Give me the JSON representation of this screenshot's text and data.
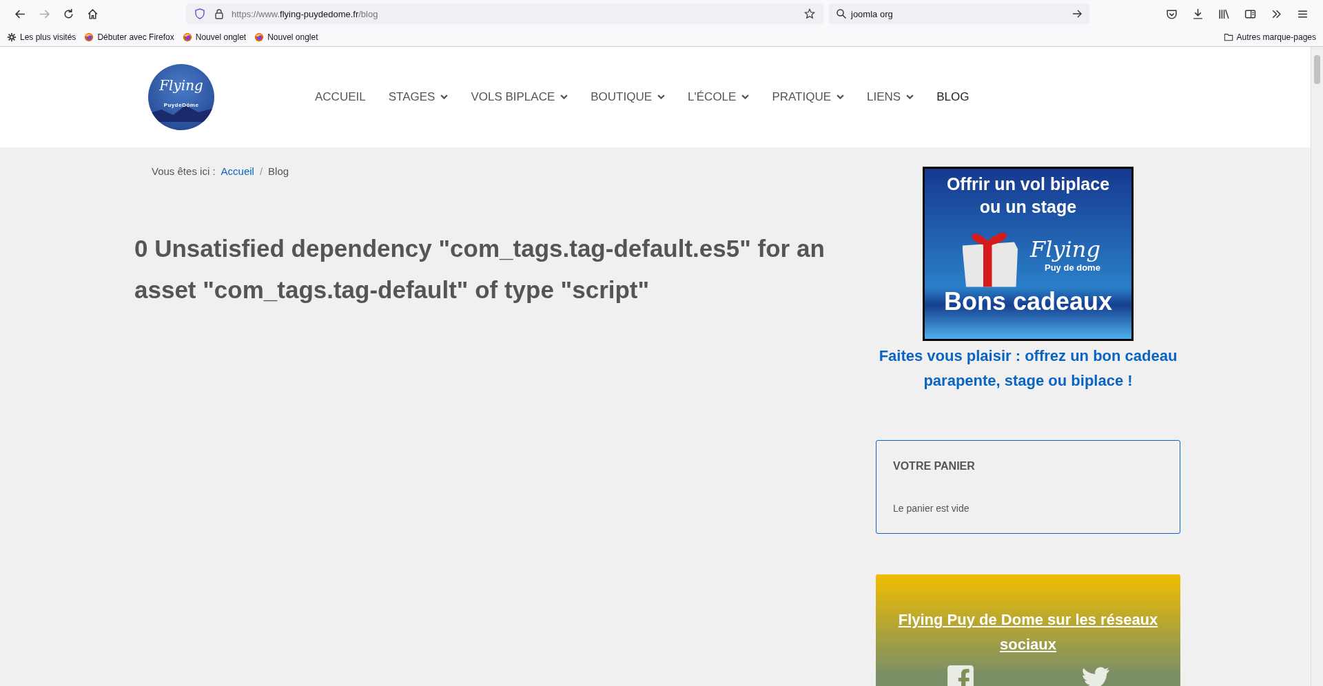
{
  "browser": {
    "url_prefix": "https://www.",
    "url_host": "flying-puydedome.fr",
    "url_path": "/blog",
    "search_value": "joomla org",
    "bookmarks": [
      {
        "label": "Les plus visités",
        "kind": "gear"
      },
      {
        "label": "Débuter avec Firefox",
        "kind": "firefox"
      },
      {
        "label": "Nouvel onglet",
        "kind": "firefox"
      },
      {
        "label": "Nouvel onglet",
        "kind": "firefox"
      }
    ],
    "other_bookmarks": "Autres marque-pages"
  },
  "logo": {
    "title": "Flying",
    "subtitle": "PuydeDôme"
  },
  "nav": [
    {
      "label": "ACCUEIL",
      "dropdown": false,
      "selected": false
    },
    {
      "label": "STAGES",
      "dropdown": true,
      "selected": false
    },
    {
      "label": "VOLS BIPLACE",
      "dropdown": true,
      "selected": false
    },
    {
      "label": "BOUTIQUE",
      "dropdown": true,
      "selected": false
    },
    {
      "label": "L'ÉCOLE",
      "dropdown": true,
      "selected": false
    },
    {
      "label": "PRATIQUE",
      "dropdown": true,
      "selected": false
    },
    {
      "label": "LIENS",
      "dropdown": true,
      "selected": false
    },
    {
      "label": "BLOG",
      "dropdown": false,
      "selected": true
    }
  ],
  "breadcrumb": {
    "prefix": "Vous êtes ici :",
    "separator": "/",
    "items": [
      {
        "label": "Accueil",
        "link": true
      },
      {
        "label": "Blog",
        "link": false
      }
    ]
  },
  "error_heading": "0 Unsatisfied dependency \"com_tags.tag-default.es5\" for an asset \"com_tags.tag-default\" of type \"script\"",
  "gift_banner": {
    "line_1": "Offrir un vol biplace",
    "line_2": "ou un stage",
    "brand": "Flying",
    "brand_sub": "Puy de dome",
    "footer": "Bons cadeaux"
  },
  "gift_caption": "Faites vous plaisir : offrez un bon cadeau parapente, stage ou biplace !",
  "cart": {
    "title": "VOTRE PANIER",
    "message": "Le panier est vide"
  },
  "social": {
    "title": "Flying Puy de Dome sur les réseaux sociaux",
    "icons": [
      {
        "kind": "facebook"
      },
      {
        "kind": "twitter"
      }
    ]
  }
}
